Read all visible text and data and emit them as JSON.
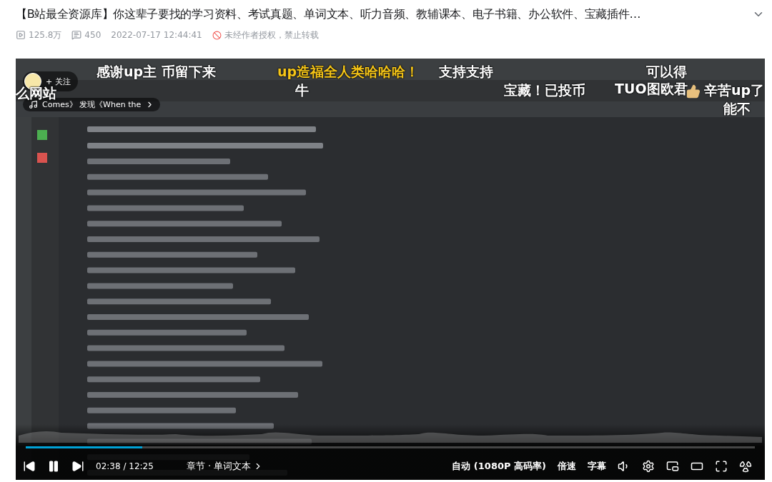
{
  "video": {
    "title": "【B站最全资源库】你这辈子要找的学习资料、考试真题、单词文本、听力音频、教辅课本、电子书籍、办公软件、宝藏插件…",
    "views": "125.8万",
    "danmaku_count": "450",
    "date": "2022-07-17 12:44:41",
    "notice": "未经作者授权，禁止转载"
  },
  "player": {
    "follow": {
      "label": "+ 关注"
    },
    "music": {
      "label": "Comes》 发现《When the"
    },
    "danmaku": [
      {
        "text": "么网站",
        "color": "#ffffff"
      },
      {
        "text": "感谢up主 币留下来",
        "color": "#ffffff"
      },
      {
        "text": "up造福全人类哈哈哈！",
        "color": "#f5c518"
      },
      {
        "text": "支持支持",
        "color": "#ffffff"
      },
      {
        "text": "可以得",
        "color": "#ffffff"
      },
      {
        "text": "牛",
        "color": "#ffffff"
      },
      {
        "text": "宝藏！已投币",
        "color": "#ffffff"
      },
      {
        "text": "TUO图欧君",
        "color": "#ffffff"
      },
      {
        "text": "辛苦up了",
        "color": "#ffffff"
      },
      {
        "text": "能不",
        "color": "#ffffff"
      }
    ],
    "progress": {
      "level": 0.16
    },
    "time": "02:38 / 12:25",
    "chapter": "章节 · 单词文本",
    "quality": "自动 (1080P 高码率)",
    "speed": "倍速",
    "subtitles": "字幕",
    "playing": true
  }
}
